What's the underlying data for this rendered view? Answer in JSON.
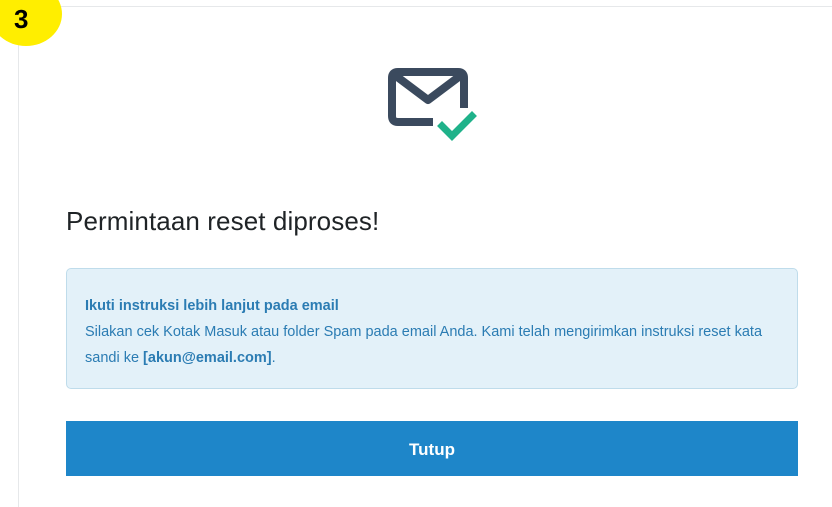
{
  "step_badge": "3",
  "dialog": {
    "title": "Permintaan reset diproses!",
    "notice": {
      "heading": "Ikuti instruksi lebih lanjut pada email",
      "body_before": "Silakan cek Kotak Masuk atau folder Spam pada email Anda. Kami telah mengirimkan instruksi reset kata sandi ke ",
      "email": "[akun@email.com]",
      "body_after": "."
    },
    "close_label": "Tutup",
    "icon": "mail-check-icon"
  },
  "colors": {
    "badge": "#ffee00",
    "icon_envelope": "#3b4a5e",
    "icon_check": "#1fb28a",
    "notice_bg": "#e3f1f9",
    "notice_border": "#bfdceb",
    "notice_text": "#2b7cb3",
    "button_bg": "#1e86c9",
    "title_text": "#1f2326"
  }
}
